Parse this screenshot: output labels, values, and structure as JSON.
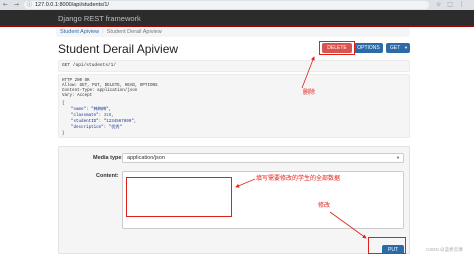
{
  "browser": {
    "nav_icons": "← → ↻",
    "lock_icon": "ⓘ",
    "url": "127.0.0.1:8000/api/students/1/",
    "ext_icons": "☆ ⬚ ⋮"
  },
  "navbar": {
    "brand": "Django REST framework"
  },
  "breadcrumb": {
    "items": [
      "Student Apiview",
      "Student Derail Apiview"
    ]
  },
  "title": "Student Derail Apiview",
  "buttons": {
    "delete": "DELETE",
    "options": "OPTIONS",
    "get": "GET",
    "put": "PUT"
  },
  "request": {
    "line": "GET /api/students/1/"
  },
  "response": {
    "status": "HTTP 200 OK",
    "allow": "Allow: GET, PUT, DELETE, HEAD, OPTIONS",
    "content_type": "Content-Type: application/json",
    "vary": "Vary: Accept",
    "json_open": "{",
    "fields": [
      {
        "key": "\"name\"",
        "value": "\"韩梅梅\"",
        "kind": "str"
      },
      {
        "key": "\"classmate\"",
        "value": "310",
        "kind": "num"
      },
      {
        "key": "\"studentID\"",
        "value": "\"1234567890\"",
        "kind": "str"
      },
      {
        "key": "\"description\"",
        "value": "\"优秀\"",
        "kind": "str"
      }
    ],
    "json_close": "}"
  },
  "form": {
    "media_type_label": "Media type:",
    "media_type_value": "application/json",
    "content_label": "Content:",
    "content_value": ""
  },
  "annotations": {
    "delete_note": "删除",
    "content_note": "填写需要修改的学生的全部数据",
    "modify_note": "修改"
  },
  "watermark": "CSDN @蓝桥云课"
}
